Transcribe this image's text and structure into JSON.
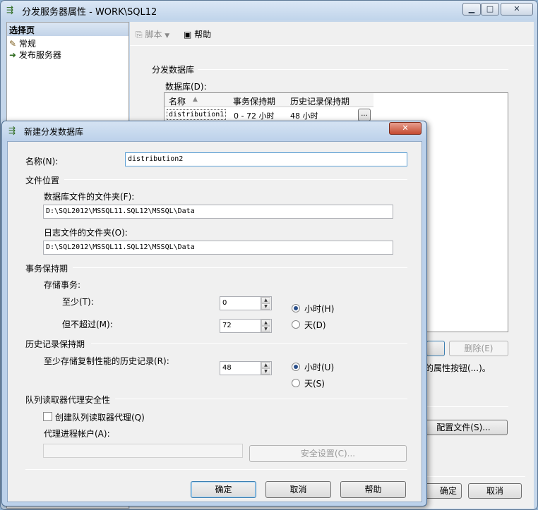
{
  "parent": {
    "title": "分发服务器属性 - WORK\\SQL12",
    "select_page_header": "选择页",
    "pages": [
      {
        "label": "常规",
        "icon": "page-general-icon"
      },
      {
        "label": "发布服务器",
        "icon": "page-publisher-icon"
      }
    ],
    "toolbar": {
      "script_label": "脚本",
      "help_label": "帮助"
    },
    "dist_db_group": "分发数据库",
    "databases_label": "数据库(D):",
    "grid_headers": [
      "名称",
      "事务保持期",
      "历史记录保持期"
    ],
    "grid_rows": [
      {
        "name": "distribution1",
        "tx": "0 - 72 小时",
        "history": "48 小时",
        "btn": "..."
      }
    ],
    "delete_button": "删除(E)",
    "note_text": "的属性按钮(...)。",
    "config_files_button": "配置文件(S)...",
    "ok_button": "确定",
    "cancel_button": "取消"
  },
  "dialog": {
    "title": "新建分发数据库",
    "name_label": "名称(N):",
    "name_value": "distribution2",
    "file_location_group": "文件位置",
    "db_folder_label": "数据库文件的文件夹(F):",
    "db_folder_value": "D:\\SQL2012\\MSSQL11.SQL12\\MSSQL\\Data",
    "log_folder_label": "日志文件的文件夹(O):",
    "log_folder_value": "D:\\SQL2012\\MSSQL11.SQL12\\MSSQL\\Data",
    "tx_retention_group": "事务保持期",
    "store_tx_label": "存储事务:",
    "at_least_label": "至少(T):",
    "at_least_value": "0",
    "not_more_label": "但不超过(M):",
    "not_more_value": "72",
    "tx_unit_hours": "小时(H)",
    "tx_unit_days": "天(D)",
    "tx_unit_selected": "hours",
    "history_group": "历史记录保持期",
    "history_label": "至少存储复制性能的历史记录(R):",
    "history_value": "48",
    "hist_unit_hours": "小时(U)",
    "hist_unit_days": "天(S)",
    "hist_unit_selected": "hours",
    "queue_group": "队列读取器代理安全性",
    "create_queue_label": "创建队列读取器代理(Q)",
    "create_queue_checked": false,
    "agent_account_label": "代理进程帐户(A):",
    "agent_account_value": "",
    "security_settings_button": "安全设置(C)...",
    "ok_button": "确定",
    "cancel_button": "取消",
    "help_button": "帮助"
  }
}
